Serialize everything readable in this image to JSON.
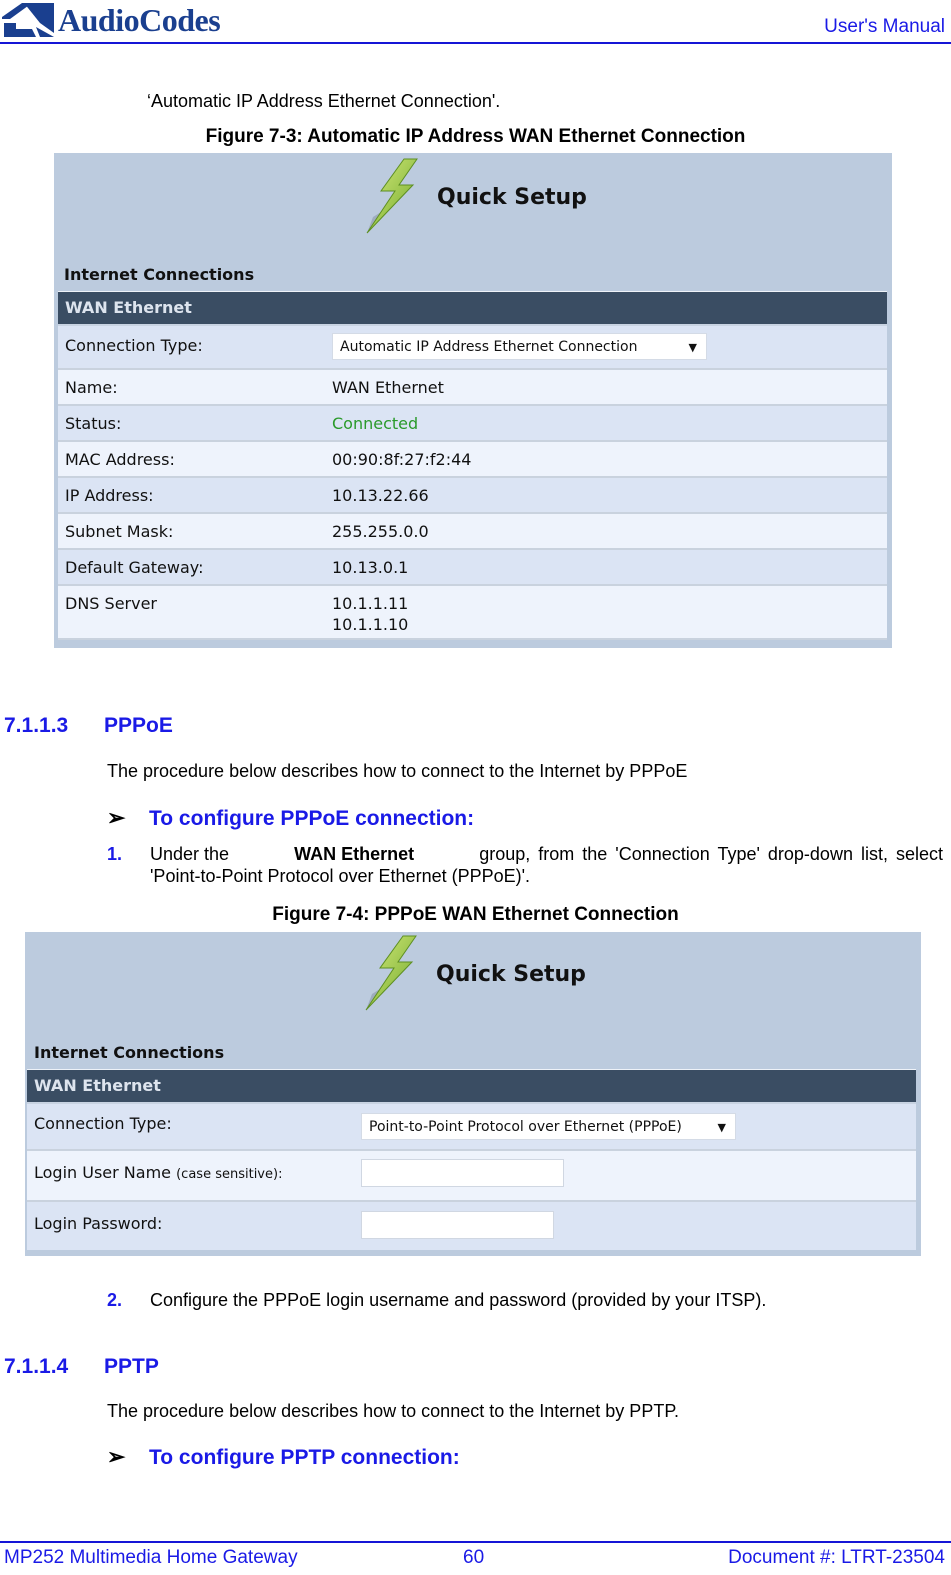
{
  "header": {
    "logo_text": "AudioCodes",
    "right_title": "User's Manual"
  },
  "intro_fragment": "‘Automatic IP Address Ethernet Connection'.",
  "figure1": {
    "caption": "Figure 7-3: Automatic IP Address WAN Ethernet Connection",
    "quick_setup_title": "Quick Setup",
    "section_title": "Internet Connections",
    "group_title": "WAN Ethernet",
    "connection_type_label": "Connection Type:",
    "connection_type_value": "Automatic IP Address Ethernet Connection",
    "rows": [
      {
        "label": "Name:",
        "value": "WAN Ethernet"
      },
      {
        "label": "Status:",
        "value": "Connected"
      },
      {
        "label": "MAC Address:",
        "value": "00:90:8f:27:f2:44"
      },
      {
        "label": "IP Address:",
        "value": "10.13.22.66"
      },
      {
        "label": "Subnet Mask:",
        "value": "255.255.0.0"
      },
      {
        "label": "Default Gateway:",
        "value": "10.13.0.1"
      }
    ],
    "dns_label": "DNS Server",
    "dns_values": [
      "10.1.1.11",
      "10.1.1.10"
    ],
    "status_color": "#2a9a2a"
  },
  "section_pppoe": {
    "number": "7.1.1.3",
    "title": "PPPoE",
    "intro": "The procedure below describes how to connect to the Internet by PPPoE",
    "procedure_title": "To configure PPPoE connection:",
    "step1_num": "1.",
    "step1_pre": "Under the",
    "step1_bold": "WAN Ethernet",
    "step1_post": "group, from the 'Connection Type' drop-down list, select",
    "step1_line2": "'Point-to-Point Protocol over Ethernet (PPPoE)'.",
    "step2_num": "2.",
    "step2_text": "Configure the PPPoE login username and password (provided by your ITSP)."
  },
  "figure2": {
    "caption": "Figure 7-4: PPPoE WAN Ethernet Connection",
    "quick_setup_title": "Quick Setup",
    "section_title": "Internet Connections",
    "group_title": "WAN Ethernet",
    "connection_type_label": "Connection Type:",
    "connection_type_value": "Point-to-Point Protocol over Ethernet (PPPoE)",
    "login_user_label": "Login User Name",
    "login_user_hint": "(case sensitive):",
    "login_user_value": "",
    "login_password_label": "Login Password:",
    "login_password_value": ""
  },
  "section_pptp": {
    "number": "7.1.1.4",
    "title": "PPTP",
    "intro": "The procedure below describes how to connect to the Internet by PPTP.",
    "procedure_title": "To configure PPTP connection:"
  },
  "footer": {
    "left": "MP252 Multimedia Home Gateway",
    "page": "60",
    "right": "Document #: LTRT-23504"
  }
}
